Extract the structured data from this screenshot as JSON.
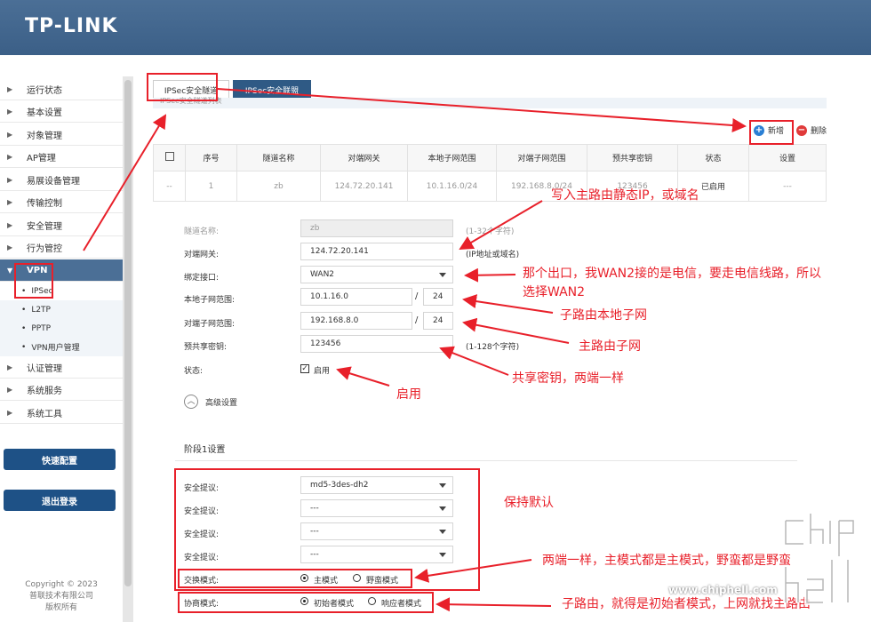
{
  "brand": {
    "logo": "TP-LINK"
  },
  "sidebar": {
    "items": [
      {
        "label": "运行状态"
      },
      {
        "label": "基本设置"
      },
      {
        "label": "对象管理"
      },
      {
        "label": "AP管理"
      },
      {
        "label": "易展设备管理"
      },
      {
        "label": "传输控制"
      },
      {
        "label": "安全管理"
      },
      {
        "label": "行为管控"
      },
      {
        "label": "VPN"
      }
    ],
    "vpn_subitems": [
      {
        "label": "IPSec"
      },
      {
        "label": "L2TP"
      },
      {
        "label": "PPTP"
      },
      {
        "label": "VPN用户管理"
      }
    ],
    "items_after": [
      {
        "label": "认证管理"
      },
      {
        "label": "系统服务"
      },
      {
        "label": "系统工具"
      }
    ],
    "quick_config": "快速配置",
    "logout": "退出登录",
    "copyright": [
      "Copyright © 2023",
      "普联技术有限公司",
      "版权所有"
    ]
  },
  "tabs": [
    {
      "label": "IPSec安全隧道"
    },
    {
      "label": "IPSec安全联盟"
    }
  ],
  "tab_subtitle": "IPSec安全隧道列表",
  "toolbar": {
    "add": "新增",
    "delete": "删除"
  },
  "table": {
    "headers": [
      "序号",
      "隧道名称",
      "对端网关",
      "本地子网范围",
      "对端子网范围",
      "预共享密钥",
      "状态",
      "设置"
    ],
    "row": {
      "check": "--",
      "cells": [
        "1",
        "zb",
        "124.72.20.141",
        "10.1.16.0/24",
        "192.168.8.0/24",
        "123456",
        "已启用",
        "---"
      ]
    }
  },
  "form": {
    "tunnel_name": {
      "label": "隧道名称:",
      "value": "zb",
      "hint": "(1-32个字符)"
    },
    "peer_gateway": {
      "label": "对端网关:",
      "value": "124.72.20.141",
      "hint": "(IP地址或域名)"
    },
    "bind_interface": {
      "label": "绑定接口:",
      "value": "WAN2"
    },
    "local_subnet": {
      "label": "本地子网范围:",
      "ip": "10.1.16.0",
      "mask": "24"
    },
    "peer_subnet": {
      "label": "对端子网范围:",
      "ip": "192.168.8.0",
      "mask": "24"
    },
    "psk": {
      "label": "预共享密钥:",
      "value": "123456",
      "hint": "(1-128个字符)"
    },
    "status": {
      "label": "状态:",
      "option": "启用",
      "checked": true
    },
    "advanced": "高级设置",
    "phase1_title": "阶段1设置",
    "proposals": [
      {
        "label": "安全提议:",
        "value": "md5-3des-dh2"
      },
      {
        "label": "安全提议:",
        "value": "---"
      },
      {
        "label": "安全提议:",
        "value": "---"
      },
      {
        "label": "安全提议:",
        "value": "---"
      }
    ],
    "exchange_mode": {
      "label": "交换模式:",
      "options": [
        "主模式",
        "野蛮模式"
      ],
      "selected": 0
    },
    "negotiation_mode": {
      "label": "协商模式:",
      "options": [
        "初始者模式",
        "响应者模式"
      ],
      "selected": 0
    }
  },
  "annotations": {
    "a1": "写入主路由静态IP，或域名",
    "a2": "那个出口，我WAN2接的是电信，要走电信线路，所以",
    "a2b": "选择WAN2",
    "a3": "子路由本地子网",
    "a4": "主路由子网",
    "a5": "共享密钥，两端一样",
    "a6": "启用",
    "a7": "保持默认",
    "a8": "两端一样，主模式都是主模式，野蛮都是野蛮",
    "a9": "子路由，就得是初始者模式，上网就找主路由"
  },
  "watermark": {
    "site": "www.chiphell.com"
  },
  "colors": {
    "header": "#3b5f87",
    "accent": "#1e5186",
    "annotation": "#e8202a",
    "add": "#2a7fd4",
    "delete": "#e03a3a"
  }
}
